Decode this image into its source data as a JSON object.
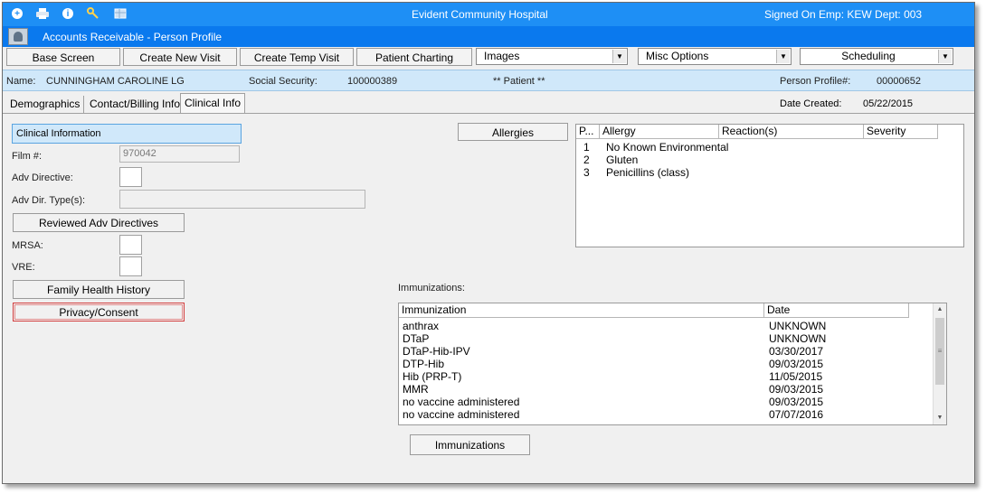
{
  "window": {
    "title": "Evident Community Hospital",
    "user_info": "Signed On Emp: KEW  Dept: 003",
    "toolbar_icons": [
      "plus-circle-icon",
      "printer-icon",
      "info-icon",
      "key-icon",
      "grid-icon"
    ]
  },
  "module": {
    "title": "Accounts Receivable - Person Profile",
    "icon": "person-profile-icon"
  },
  "toolbar": {
    "base_screen": "Base Screen",
    "create_new_visit": "Create New Visit",
    "create_temp_visit": "Create Temp Visit",
    "patient_charting": "Patient Charting",
    "images": "Images",
    "misc_options": "Misc Options",
    "scheduling": "Scheduling"
  },
  "patient": {
    "name_label": "Name:",
    "name_value": "CUNNINGHAM CAROLINE LG",
    "ssn_label": "Social Security:",
    "ssn_value": "100000389",
    "flag": "** Patient **",
    "profile_label": "Person Profile#:",
    "profile_value": "00000652"
  },
  "tabs": [
    {
      "label": "Demographics"
    },
    {
      "label": "Contact/Billing Info"
    },
    {
      "label": "Clinical Info"
    }
  ],
  "date_created": {
    "label": "Date Created:",
    "value": "05/22/2015"
  },
  "clinical": {
    "header": "Clinical Information",
    "film_label": "Film #:",
    "film_value": "970042",
    "adv_directive_label": "Adv Directive:",
    "adv_directive_value": "",
    "adv_dir_types_label": "Adv Dir. Type(s):",
    "adv_dir_types_value": "",
    "reviewed_button": "Reviewed Adv Directives",
    "mrsa_label": "MRSA:",
    "mrsa_value": "",
    "vre_label": "VRE:",
    "vre_value": "",
    "family_history_button": "Family Health History",
    "privacy_button": "Privacy/Consent"
  },
  "allergies": {
    "button": "Allergies",
    "columns": [
      "P...",
      "Allergy",
      "Reaction(s)",
      "Severity"
    ],
    "rows": [
      {
        "p": "1",
        "allergy": "No Known Environmental",
        "reaction": "",
        "severity": ""
      },
      {
        "p": "2",
        "allergy": "Gluten",
        "reaction": "",
        "severity": ""
      },
      {
        "p": "3",
        "allergy": "Penicillins (class)",
        "reaction": "",
        "severity": ""
      }
    ]
  },
  "immunizations": {
    "label": "Immunizations:",
    "button": "Immunizations",
    "columns": [
      "Immunization",
      "Date"
    ],
    "rows": [
      {
        "name": "anthrax",
        "date": "UNKNOWN"
      },
      {
        "name": "DTaP",
        "date": "UNKNOWN"
      },
      {
        "name": "DTaP-Hib-IPV",
        "date": "03/30/2017"
      },
      {
        "name": "DTP-Hib",
        "date": "09/03/2015"
      },
      {
        "name": "Hib (PRP-T)",
        "date": "11/05/2015"
      },
      {
        "name": "MMR",
        "date": "09/03/2015"
      },
      {
        "name": "no vaccine administered",
        "date": "09/03/2015"
      },
      {
        "name": "no vaccine administered",
        "date": "07/07/2016"
      }
    ]
  }
}
